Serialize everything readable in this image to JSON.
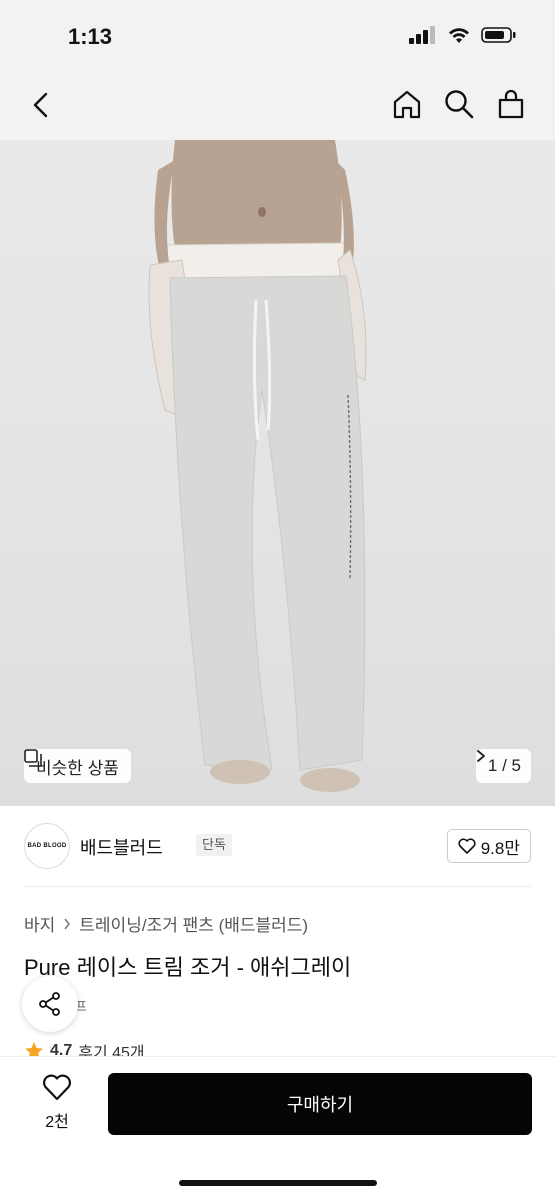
{
  "status": {
    "time": "1:13"
  },
  "hero": {
    "similar_label": "비슷한 상품",
    "page_indicator": "1 / 5"
  },
  "brand": {
    "logo_text": "BAD BLOOD",
    "name": "배드블러드",
    "tag": "단독",
    "likes": "9.8만"
  },
  "breadcrumb": [
    "바지",
    "트레이닝/조거 팬츠 (배드블러드)"
  ],
  "product": {
    "title": "Pure 레이스 트림 조거 - 애쉬그레이",
    "sub_tag": "프",
    "rating": "4.7",
    "reviews": "후기 45개"
  },
  "bottom": {
    "wish_count": "2천",
    "buy_label": "구매하기"
  },
  "colors": {
    "buy_bg": "#050505",
    "header_bg": "#f2f2f2",
    "star": "#f5a623"
  }
}
